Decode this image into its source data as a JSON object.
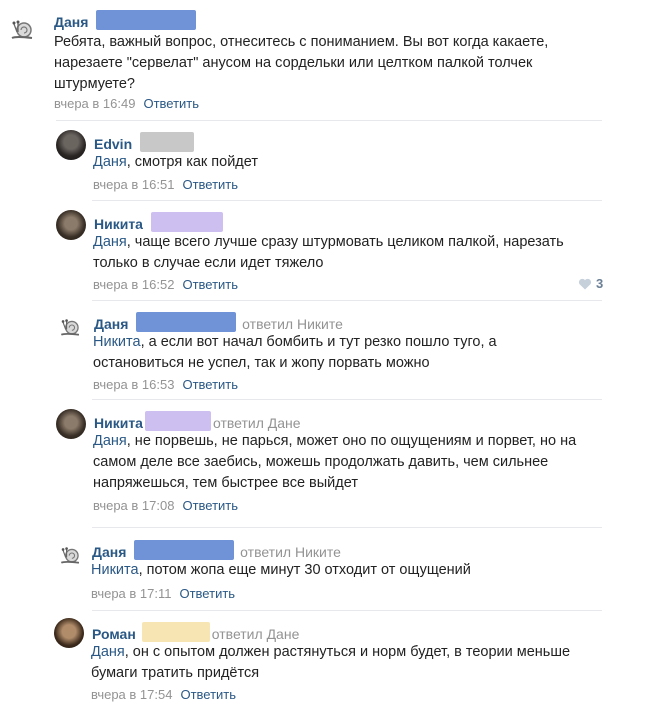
{
  "comments": [
    {
      "author": "Даня",
      "replied_to": "",
      "mention": "",
      "text": "Ребята, важный вопрос, отнеситесь с пониманием. Вы вот когда какаете, нарезаете \"сервелат\" анусом на сордельки или целтком палкой толчек штурмуете?",
      "time": "вчера в 16:49",
      "reply_label": "Ответить"
    },
    {
      "author": "Edvin",
      "replied_to": "",
      "mention": "Даня",
      "text": ", смотря как пойдет",
      "time": "вчера в 16:51",
      "reply_label": "Ответить"
    },
    {
      "author": "Никита",
      "replied_to": "",
      "mention": "Даня",
      "text": ", чаще всего лучше сразу штурмовать целиком палкой, нарезать только в случае если идет тяжело",
      "time": "вчера в 16:52",
      "reply_label": "Ответить",
      "likes": "3"
    },
    {
      "author": "Даня",
      "replied_to": "ответил Никите",
      "mention": "Никита",
      "text": ", а если вот начал бомбить и тут резко пошло туго, а остановиться не успел, так и жопу порвать можно",
      "time": "вчера в 16:53",
      "reply_label": "Ответить"
    },
    {
      "author": "Никита",
      "replied_to": "ответил Дане",
      "mention": "Даня",
      "text": ", не порвешь, не парься, может оно по ощущениям и порвет, но на самом деле все заебись, можешь продолжать давить, чем сильнее напряжешься, тем быстрее все выйдет",
      "time": "вчера в 17:08",
      "reply_label": "Ответить"
    },
    {
      "author": "Даня",
      "replied_to": "ответил Никите",
      "mention": "Никита",
      "text": ", потом жопа еще минут 30 отходит от ощущений",
      "time": "вчера в 17:11",
      "reply_label": "Ответить"
    },
    {
      "author": "Роман",
      "replied_to": "ответил Дане",
      "mention": "Даня",
      "text": ", он с опытом должен растянуться и норм будет, в теории меньше бумаги тратить придётся",
      "time": "вчера в 17:54",
      "reply_label": "Ответить"
    }
  ]
}
